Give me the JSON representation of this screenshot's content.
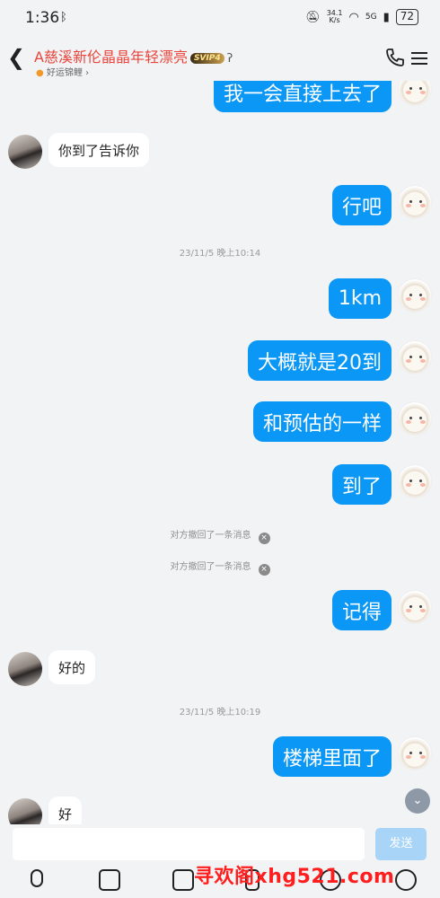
{
  "status": {
    "time": "1:36",
    "speed_value": "34.1",
    "speed_unit": "K/s",
    "network": "5G",
    "battery": "72"
  },
  "header": {
    "title": "A慈溪新伦晶晶年轻漂亮",
    "vip": "SVIP4",
    "subtitle": "好运锦鲤"
  },
  "messages": [
    {
      "type": "out",
      "text": "我一会直接上去了"
    },
    {
      "type": "in",
      "text": "你到了告诉你"
    },
    {
      "type": "out",
      "text": "行吧"
    },
    {
      "type": "time",
      "text": "23/11/5 晚上10:14"
    },
    {
      "type": "out",
      "text": "1km"
    },
    {
      "type": "out",
      "text": "大概就是20到"
    },
    {
      "type": "out",
      "text": "和预估的一样"
    },
    {
      "type": "out",
      "text": "到了"
    },
    {
      "type": "recall",
      "text": "对方撤回了一条消息"
    },
    {
      "type": "recall",
      "text": "对方撤回了一条消息"
    },
    {
      "type": "out",
      "text": "记得"
    },
    {
      "type": "in",
      "text": "好的"
    },
    {
      "type": "time",
      "text": "23/11/5 晚上10:19"
    },
    {
      "type": "out",
      "text": "楼梯里面了"
    },
    {
      "type": "in",
      "text": "好"
    }
  ],
  "input": {
    "value": "",
    "send_label": "发送"
  },
  "toolbar": [
    "mic-icon",
    "image-icon",
    "camera-icon",
    "file-icon",
    "emoji-icon",
    "plus-icon"
  ],
  "watermark": "寻欢阁xhg521.com"
}
